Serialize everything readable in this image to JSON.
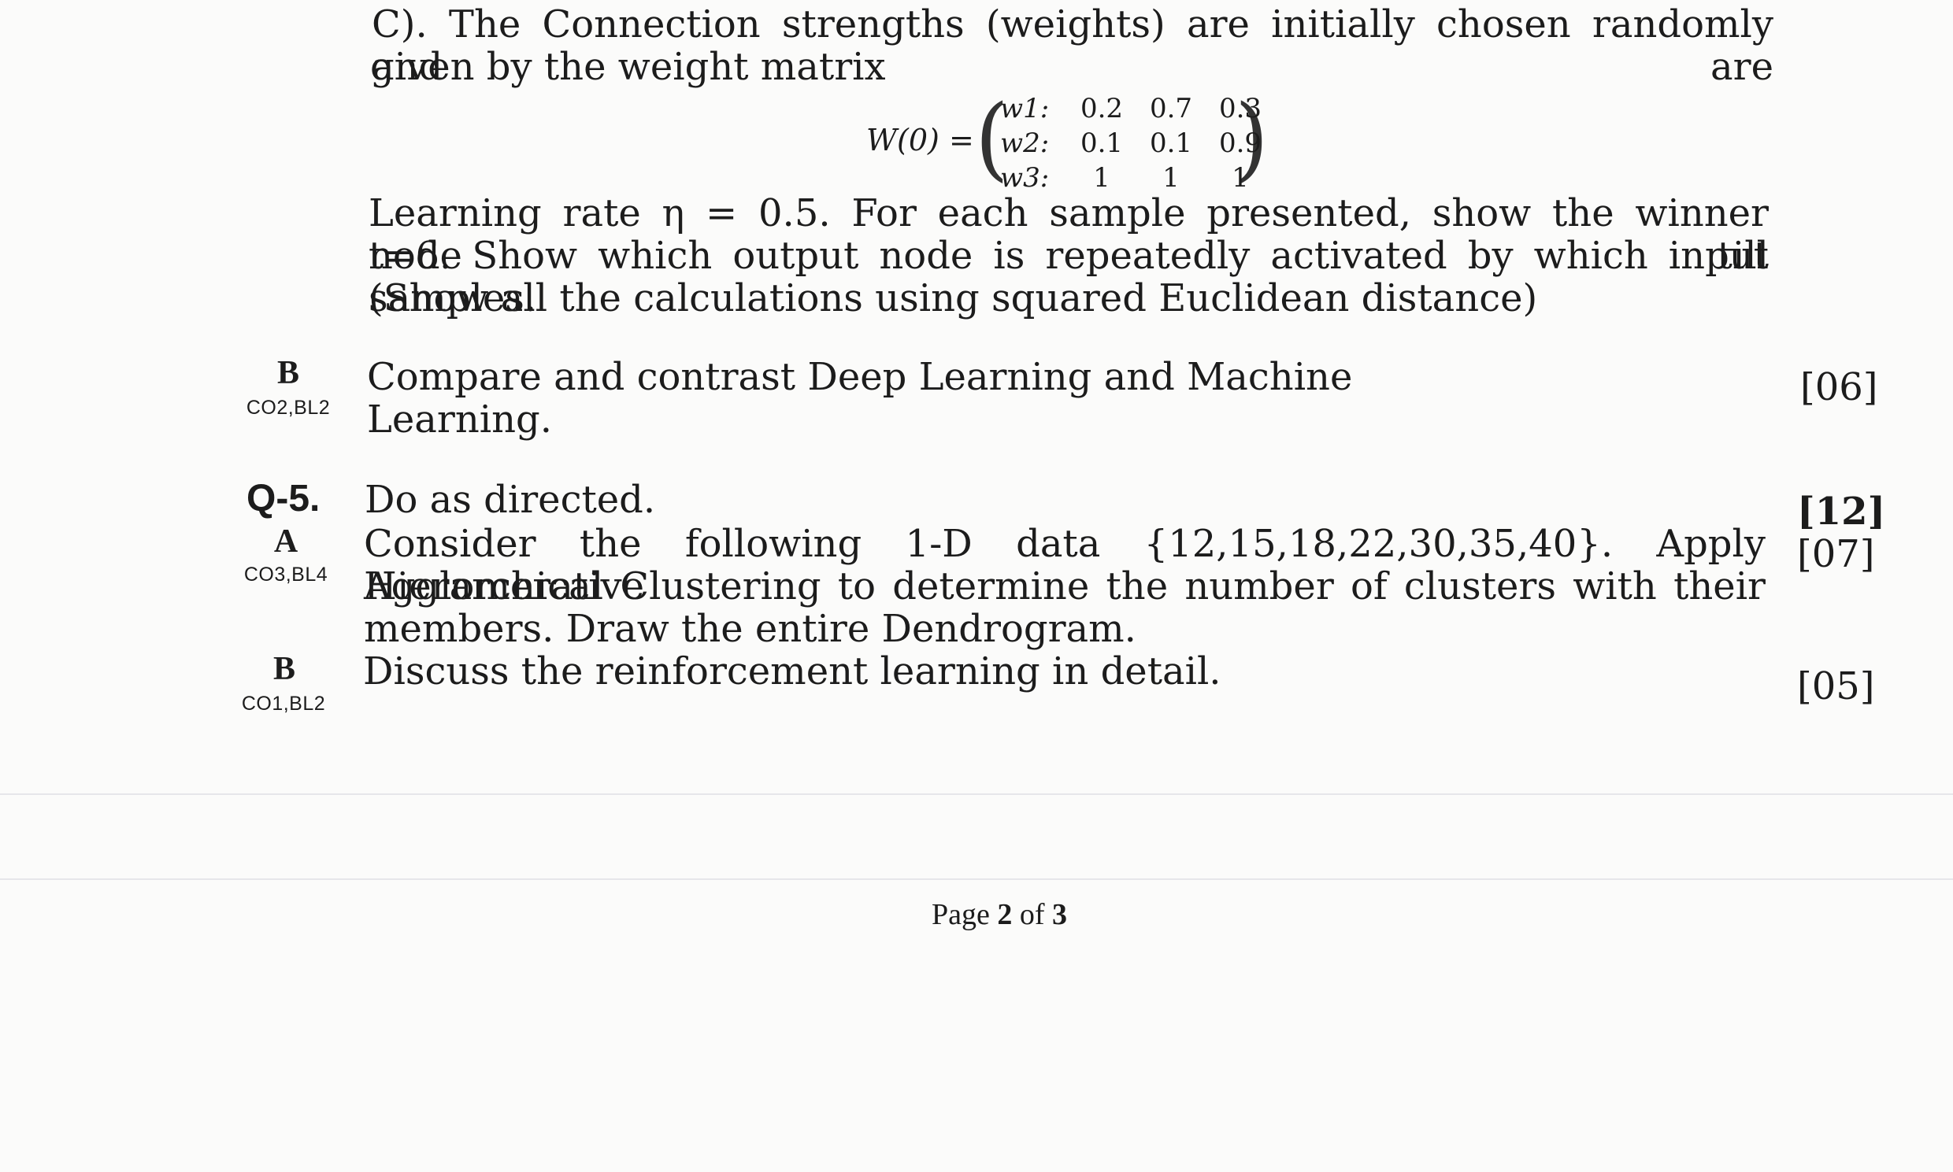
{
  "q4": {
    "para1_line1": "C). The Connection strengths (weights) are initially chosen randomly and are",
    "para1_line2": "given by the weight matrix",
    "matrix": {
      "label": "W(0) =",
      "rows": [
        {
          "name": "w1:",
          "v1": "0.2",
          "v2": "0.7",
          "v3": "0.3"
        },
        {
          "name": "w2:",
          "v1": "0.1",
          "v2": "0.1",
          "v3": "0.9"
        },
        {
          "name": "w3:",
          "v1": "1",
          "v2": "1",
          "v3": "1"
        }
      ]
    },
    "para2_line1": "Learning rate η = 0.5. For each sample presented, show the winner node till",
    "para2_line2": "t=6. Show which output node is repeatedly activated by which input samples.",
    "para2_line3": "(Show all the calculations using squared Euclidean distance)",
    "b": {
      "letter": "B",
      "co": "CO2,BL2",
      "text": "Compare and contrast Deep Learning and Machine Learning.",
      "marks": "[06]"
    }
  },
  "q5": {
    "number": "Q-5.",
    "heading": "Do as directed.",
    "marks": "[12]",
    "a": {
      "letter": "A",
      "co": "CO3,BL4",
      "line1": "Consider the following 1-D data {12,15,18,22,30,35,40}. Apply Agglomerative",
      "line2": "Hierarchical Clustering to determine the number of clusters with their",
      "line3": "members. Draw the entire Dendrogram.",
      "marks": "[07]"
    },
    "b": {
      "letter": "B",
      "co": "CO1,BL2",
      "text": "Discuss the reinforcement learning in detail.",
      "marks": "[05]"
    }
  },
  "footer": {
    "page_prefix": "Page",
    "page_current": "2",
    "page_of": "of",
    "page_total": "3"
  }
}
